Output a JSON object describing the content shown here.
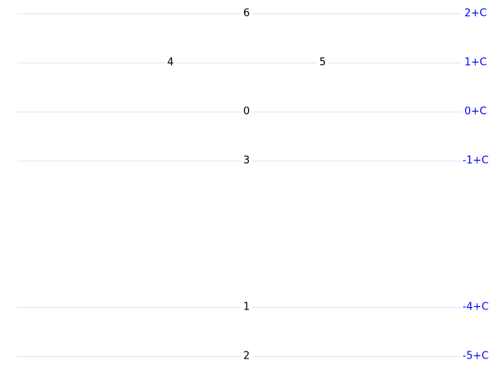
{
  "level_color": "#0000ff",
  "line_color": "#e0e0ff",
  "levels": [
    {
      "value": 2,
      "label": "2+C"
    },
    {
      "value": 1,
      "label": "1+C"
    },
    {
      "value": 0,
      "label": "0+C"
    },
    {
      "value": -1,
      "label": "-1+C"
    },
    {
      "value": -4,
      "label": "-4+C"
    },
    {
      "value": -5,
      "label": "-5+C"
    }
  ],
  "nodes": [
    {
      "label": "6",
      "level": 2,
      "column": 0
    },
    {
      "label": "4",
      "level": 1,
      "column": -1
    },
    {
      "label": "5",
      "level": 1,
      "column": 1
    },
    {
      "label": "0",
      "level": 0,
      "column": 0
    },
    {
      "label": "3",
      "level": -1,
      "column": 0
    },
    {
      "label": "1",
      "level": -4,
      "column": 0
    },
    {
      "label": "2",
      "level": -5,
      "column": 0
    }
  ]
}
